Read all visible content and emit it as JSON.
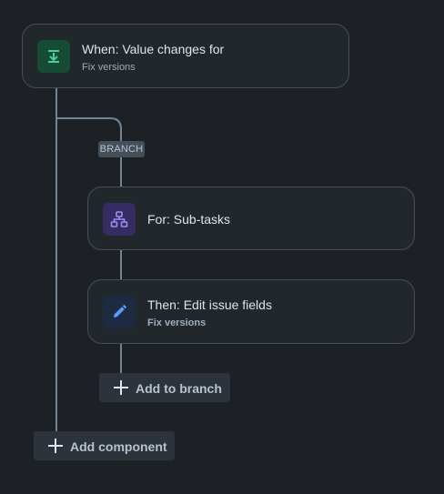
{
  "trigger": {
    "title": "When: Value changes for",
    "subtitle": "Fix versions",
    "icon": "download-tray-icon",
    "icon_bg": "#164b35",
    "icon_color": "#4bce97"
  },
  "branch": {
    "badge": "BRANCH",
    "for_component": {
      "title": "For: Sub-tasks",
      "icon": "hierarchy-icon",
      "icon_bg": "#352c63",
      "icon_color": "#9f8fef"
    },
    "action": {
      "title": "Then: Edit issue fields",
      "subtitle": "Fix versions",
      "icon": "pencil-icon",
      "icon_bg": "#1c2b41",
      "icon_color": "#579dff"
    },
    "add_label": "Add to branch"
  },
  "add_component_label": "Add component",
  "colors": {
    "background": "#1d2125",
    "card": "#22272b",
    "card_border": "#454f59",
    "connector": "#738496",
    "button_bg": "#2c333a"
  }
}
